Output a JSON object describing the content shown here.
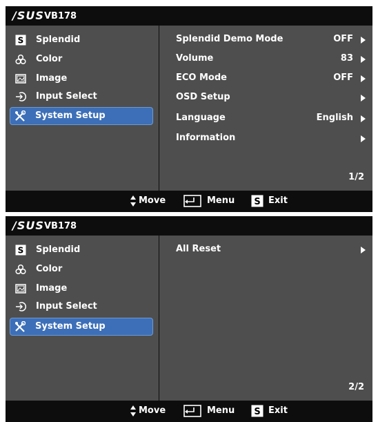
{
  "panels": [
    {
      "brand": "/SUS",
      "model": "VB178",
      "menu": [
        {
          "label": "Splendid",
          "icon": "splendid-icon"
        },
        {
          "label": "Color",
          "icon": "color-icon"
        },
        {
          "label": "Image",
          "icon": "image-icon"
        },
        {
          "label": "Input Select",
          "icon": "input-select-icon"
        },
        {
          "label": "System Setup",
          "icon": "system-setup-icon",
          "selected": true
        }
      ],
      "settings": [
        {
          "label": "Splendid Demo Mode",
          "value": "OFF"
        },
        {
          "label": "Volume",
          "value": "83"
        },
        {
          "label": "ECO Mode",
          "value": "OFF"
        },
        {
          "label": "OSD Setup",
          "value": ""
        },
        {
          "label": "Language",
          "value": "English"
        },
        {
          "label": "Information",
          "value": ""
        }
      ],
      "page": "1/2"
    },
    {
      "brand": "/SUS",
      "model": "VB178",
      "menu": [
        {
          "label": "Splendid",
          "icon": "splendid-icon"
        },
        {
          "label": "Color",
          "icon": "color-icon"
        },
        {
          "label": "Image",
          "icon": "image-icon"
        },
        {
          "label": "Input Select",
          "icon": "input-select-icon"
        },
        {
          "label": "System Setup",
          "icon": "system-setup-icon",
          "selected": true
        }
      ],
      "settings": [
        {
          "label": "All Reset",
          "value": ""
        }
      ],
      "page": "2/2"
    }
  ],
  "footer": {
    "move_label": "Move",
    "menu_label": "Menu",
    "exit_label": "Exit",
    "exit_icon_letter": "S"
  },
  "splendid_icon_letter": "S",
  "colors": {
    "selected_bg": "#3d6fb8",
    "pane_bg": "#4e4e4e",
    "bar_bg": "#0d0d0d"
  }
}
